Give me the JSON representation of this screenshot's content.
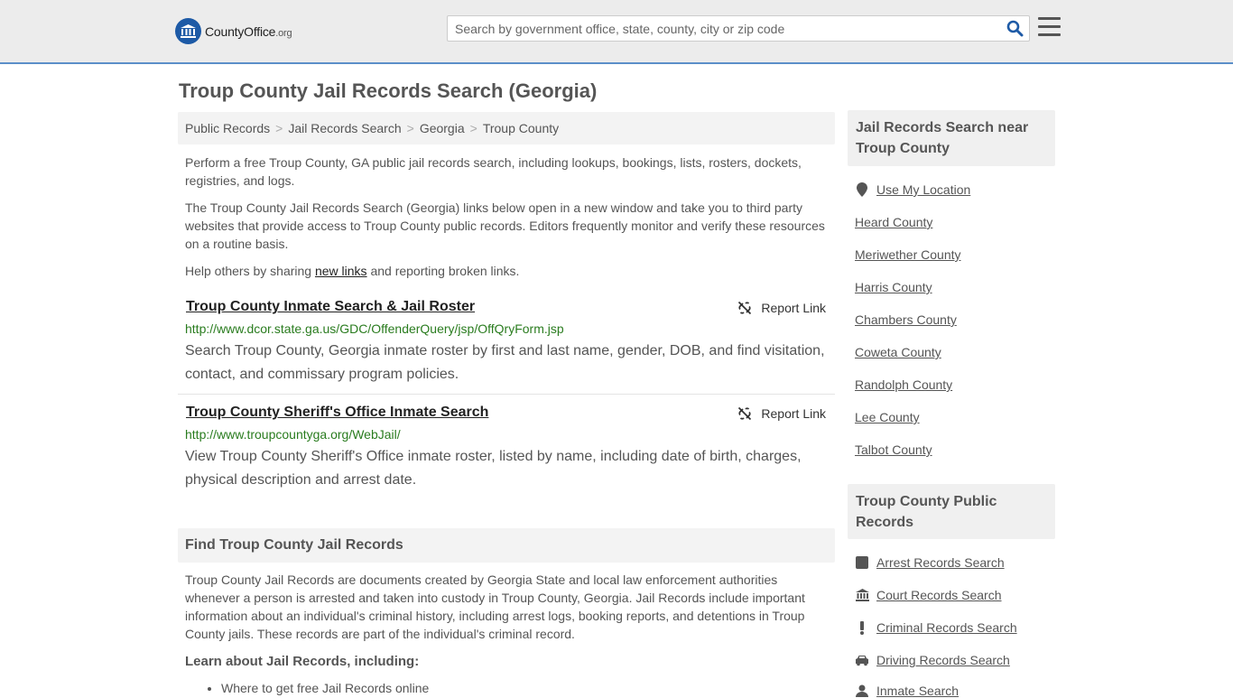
{
  "header": {
    "logo_main": "CountyOffice",
    "logo_suffix": ".org",
    "search_placeholder": "Search by government office, state, county, city or zip code"
  },
  "page_title": "Troup County Jail Records Search (Georgia)",
  "breadcrumb": [
    "Public Records",
    "Jail Records Search",
    "Georgia",
    "Troup County"
  ],
  "intro": {
    "p1": "Perform a free Troup County, GA public jail records search, including lookups, bookings, lists, rosters, dockets, registries, and logs.",
    "p2": "The Troup County Jail Records Search (Georgia) links below open in a new window and take you to third party websites that provide access to Troup County public records. Editors frequently monitor and verify these resources on a routine basis.",
    "p3_before": "Help others by sharing ",
    "p3_link": "new links",
    "p3_after": " and reporting broken links."
  },
  "results": [
    {
      "title": "Troup County Inmate Search & Jail Roster",
      "report": "Report Link",
      "url": "http://www.dcor.state.ga.us/GDC/OffenderQuery/jsp/OffQryForm.jsp",
      "desc": "Search Troup County, Georgia inmate roster by first and last name, gender, DOB, and find visitation, contact, and commissary program policies."
    },
    {
      "title": "Troup County Sheriff's Office Inmate Search",
      "report": "Report Link",
      "url": "http://www.troupcountyga.org/WebJail/",
      "desc": "View Troup County Sheriff's Office inmate roster, listed by name, including date of birth, charges, physical description and arrest date."
    }
  ],
  "find_section": {
    "heading": "Find Troup County Jail Records",
    "body": "Troup County Jail Records are documents created by Georgia State and local law enforcement authorities whenever a person is arrested and taken into custody in Troup County, Georgia. Jail Records include important information about an individual's criminal history, including arrest logs, booking reports, and detentions in Troup County jails. These records are part of the individual's criminal record.",
    "learn_heading": "Learn about Jail Records, including:",
    "bullets": [
      "Where to get free Jail Records online"
    ]
  },
  "sidebar": {
    "nearby_heading": "Jail Records Search near Troup County",
    "use_location": "Use My Location",
    "nearby": [
      "Heard County",
      "Meriwether County",
      "Harris County",
      "Chambers County",
      "Coweta County",
      "Randolph County",
      "Lee County",
      "Talbot County"
    ],
    "public_heading": "Troup County Public Records",
    "public_links": [
      {
        "label": "Arrest Records Search",
        "icon": "square-icon"
      },
      {
        "label": "Court Records Search",
        "icon": "courthouse-icon"
      },
      {
        "label": "Criminal Records Search",
        "icon": "exclamation-icon"
      },
      {
        "label": "Driving Records Search",
        "icon": "car-icon"
      },
      {
        "label": "Inmate Search",
        "icon": "user-icon"
      }
    ]
  }
}
